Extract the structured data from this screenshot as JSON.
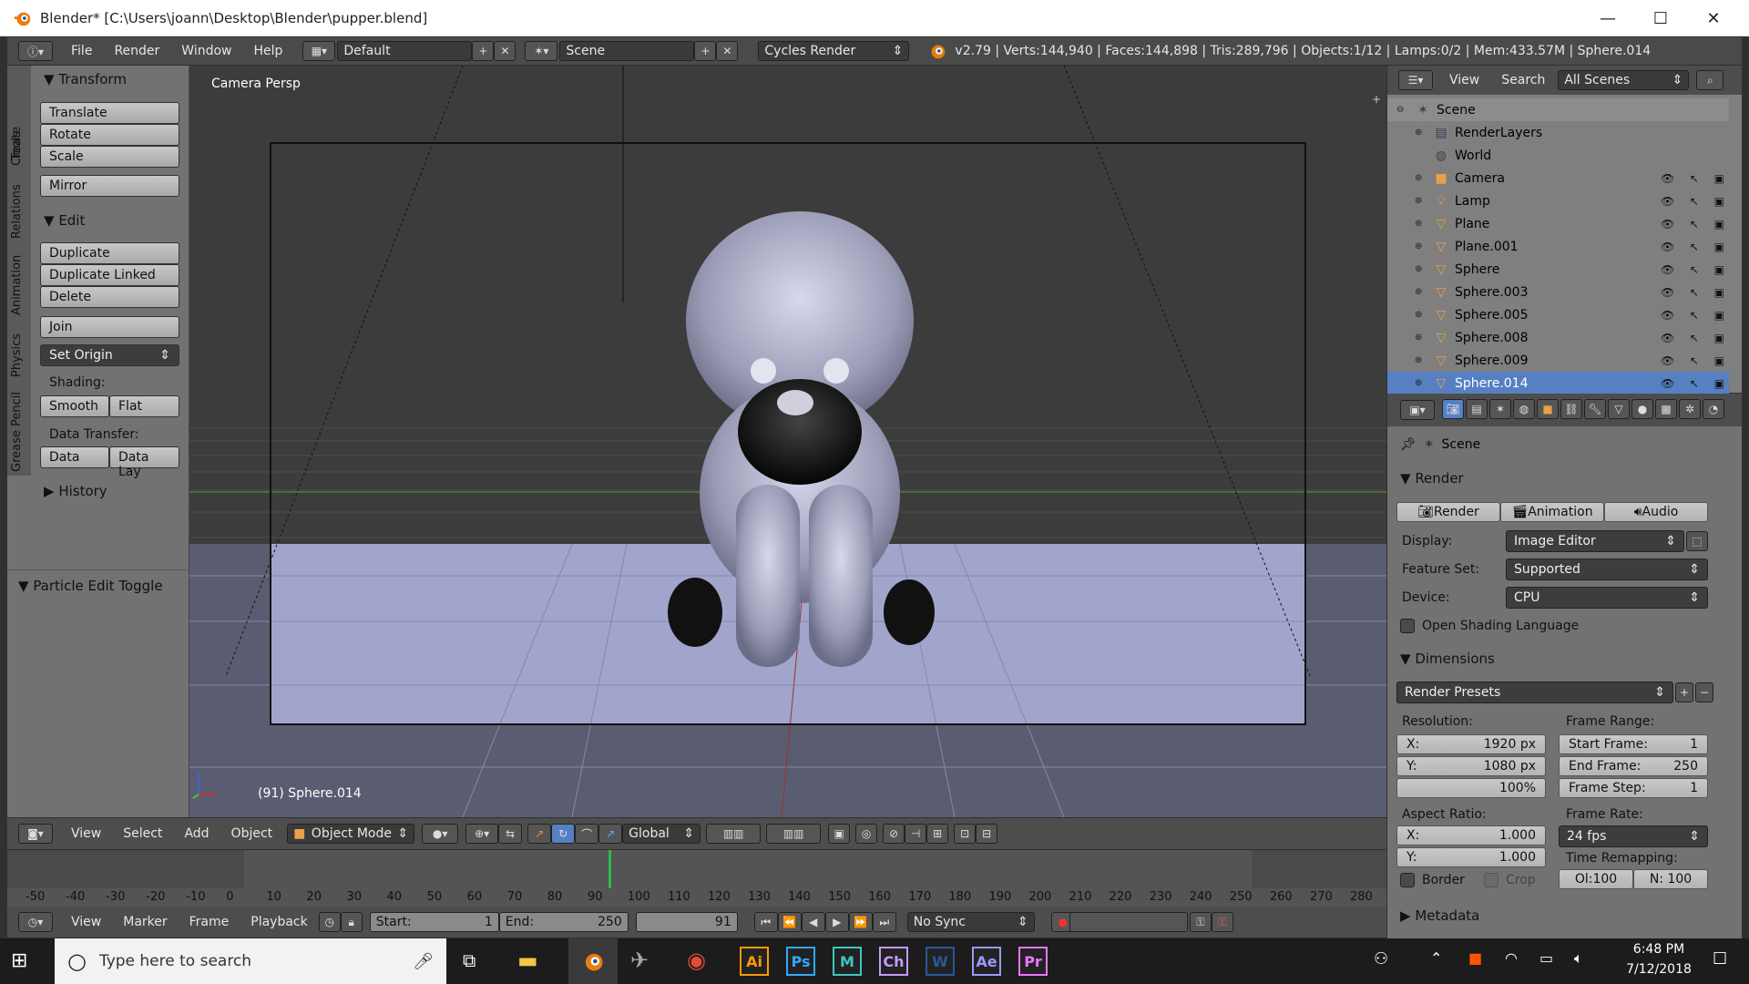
{
  "window": {
    "title": "Blender* [C:\\Users\\joann\\Desktop\\Blender\\pupper.blend]",
    "minimize": "—",
    "maximize": "☐",
    "close": "✕"
  },
  "infobar": {
    "menus": [
      "File",
      "Render",
      "Window",
      "Help"
    ],
    "layout": "Default",
    "scene": "Scene",
    "engine": "Cycles Render",
    "stats": "v2.79 | Verts:144,940 | Faces:144,898 | Tris:289,796 | Objects:1/12 | Lamps:0/2 | Mem:433.57M | Sphere.014"
  },
  "tool_tabs": [
    "Tools",
    "Create",
    "Relations",
    "Animation",
    "Physics",
    "Grease Pencil"
  ],
  "toolshelf": {
    "transform": {
      "title": "Transform",
      "buttons": [
        "Translate",
        "Rotate",
        "Scale"
      ],
      "mirror": "Mirror"
    },
    "edit": {
      "title": "Edit",
      "buttons": [
        "Duplicate",
        "Duplicate Linked",
        "Delete"
      ],
      "join": "Join",
      "set_origin": "Set Origin",
      "shading_label": "Shading:",
      "smooth": "Smooth",
      "flat": "Flat",
      "data_transfer_label": "Data Transfer:",
      "data": "Data",
      "data_lay": "Data Lay"
    },
    "history": "History",
    "particle_edit": "Particle Edit Toggle"
  },
  "viewport": {
    "label": "Camera Persp",
    "object_info": "(91) Sphere.014"
  },
  "view_footer": {
    "menus": [
      "View",
      "Select",
      "Add",
      "Object"
    ],
    "mode": "Object Mode",
    "orientation": "Global"
  },
  "timeline": {
    "ticks": [
      "-50",
      "-40",
      "-30",
      "-20",
      "-10",
      "0",
      "10",
      "20",
      "30",
      "40",
      "50",
      "60",
      "70",
      "80",
      "90",
      "100",
      "110",
      "120",
      "130",
      "140",
      "150",
      "160",
      "170",
      "180",
      "190",
      "200",
      "210",
      "220",
      "230",
      "240",
      "250",
      "260",
      "270",
      "280"
    ],
    "current_frame": 91
  },
  "timeline_bar": {
    "menus": [
      "View",
      "Marker",
      "Frame",
      "Playback"
    ],
    "start_label": "Start:",
    "start": "1",
    "end_label": "End:",
    "end": "250",
    "current": "91",
    "sync": "No Sync"
  },
  "outliner": {
    "menus": [
      "View",
      "Search"
    ],
    "filter": "All Scenes",
    "items": [
      {
        "name": "Scene",
        "icon": "scene-icon"
      },
      {
        "name": "RenderLayers",
        "icon": "renderlayers-icon"
      },
      {
        "name": "World",
        "icon": "world-icon"
      },
      {
        "name": "Camera",
        "icon": "camera-icon"
      },
      {
        "name": "Lamp",
        "icon": "lamp-icon"
      },
      {
        "name": "Plane",
        "icon": "mesh-icon"
      },
      {
        "name": "Plane.001",
        "icon": "mesh-icon"
      },
      {
        "name": "Sphere",
        "icon": "mesh-icon"
      },
      {
        "name": "Sphere.003",
        "icon": "mesh-icon"
      },
      {
        "name": "Sphere.005",
        "icon": "mesh-icon"
      },
      {
        "name": "Sphere.008",
        "icon": "mesh-icon"
      },
      {
        "name": "Sphere.009",
        "icon": "mesh-icon"
      },
      {
        "name": "Sphere.014",
        "icon": "mesh-icon"
      }
    ]
  },
  "properties": {
    "context": "Scene",
    "render": {
      "title": "Render",
      "tabs": [
        "Render",
        "Animation",
        "Audio"
      ],
      "display_label": "Display:",
      "display": "Image Editor",
      "feature_set_label": "Feature Set:",
      "feature_set": "Supported",
      "device_label": "Device:",
      "device": "CPU",
      "osl": "Open Shading Language"
    },
    "dimensions": {
      "title": "Dimensions",
      "presets": "Render Presets",
      "resolution_label": "Resolution:",
      "res_x_label": "X:",
      "res_x": "1920 px",
      "res_y_label": "Y:",
      "res_y": "1080 px",
      "res_pct": "100%",
      "frame_range_label": "Frame Range:",
      "start_frame_label": "Start Frame:",
      "start_frame": "1",
      "end_frame_label": "End Frame:",
      "end_frame": "250",
      "frame_step_label": "Frame Step:",
      "frame_step": "1",
      "aspect_label": "Aspect Ratio:",
      "aspect_x_label": "X:",
      "aspect_x": "1.000",
      "aspect_y_label": "Y:",
      "aspect_y": "1.000",
      "frame_rate_label": "Frame Rate:",
      "frame_rate": "24 fps",
      "time_remap_label": "Time Remapping:",
      "old": "Ol:100",
      "new": "N: 100",
      "border": "Border",
      "crop": "Crop"
    },
    "metadata": "Metadata"
  },
  "taskbar": {
    "search_placeholder": "Type here to search",
    "time": "6:48 PM",
    "date": "7/12/2018",
    "apps": [
      {
        "label": "Ai",
        "color": "#ff9a00"
      },
      {
        "label": "Ps",
        "color": "#31a8ff"
      },
      {
        "label": "M",
        "color": "#3ec6c0"
      },
      {
        "label": "Ch",
        "color": "#c49bff"
      },
      {
        "label": "W",
        "color": "#2b579a"
      },
      {
        "label": "Ae",
        "color": "#9999ff"
      },
      {
        "label": "Pr",
        "color": "#ea77ff"
      }
    ]
  },
  "colors": {
    "accent_orange": "#e87d0d",
    "blender_panel": "#727272",
    "timeline_cursor": "#2fb74c"
  }
}
